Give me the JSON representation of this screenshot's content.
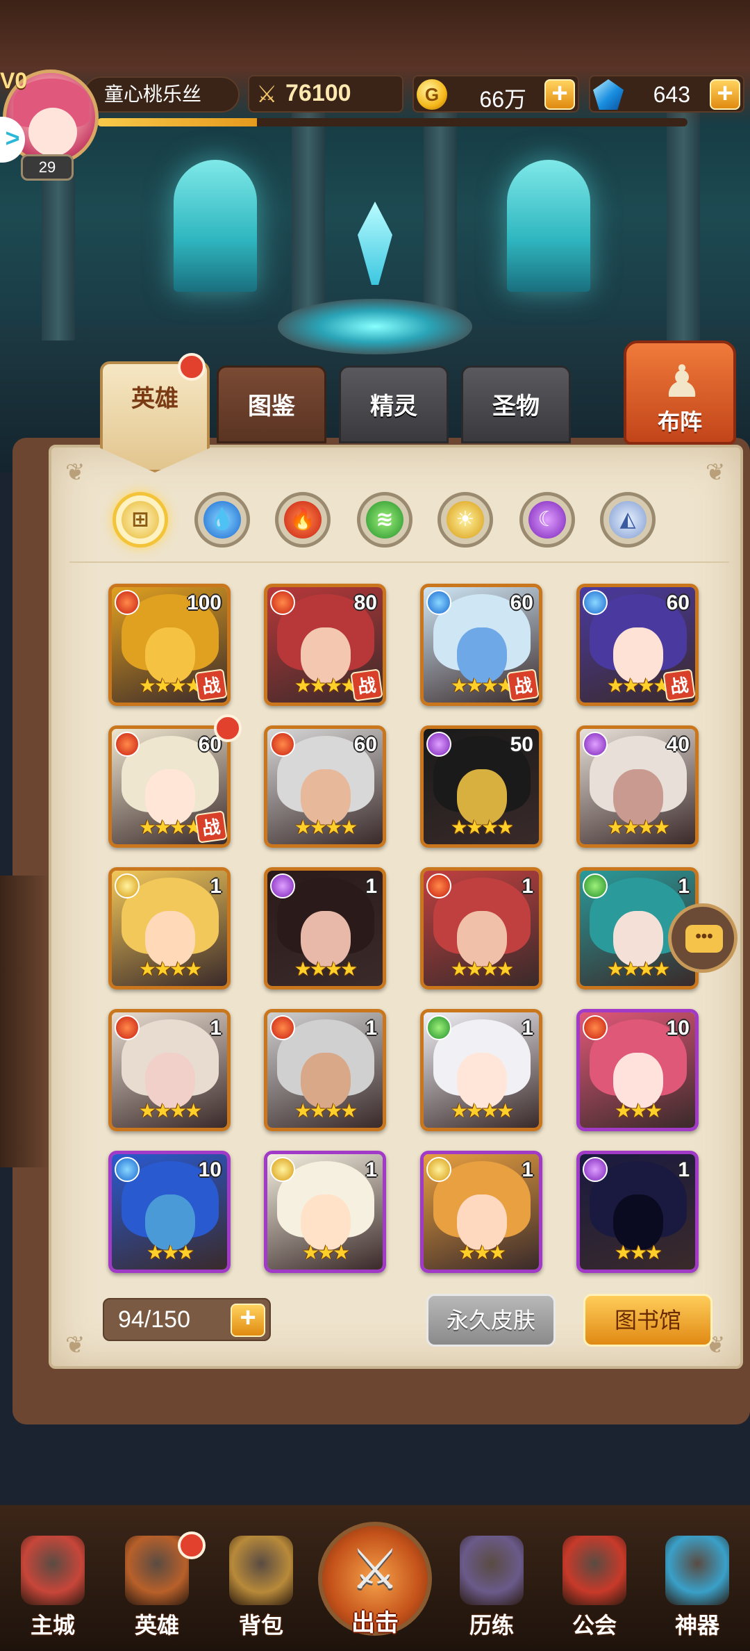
{
  "player": {
    "vip_label": "V0",
    "name": "童心桃乐丝",
    "level": "29",
    "exp_fraction": 0.27
  },
  "resources": {
    "power": "76100",
    "gold": "66万",
    "gems": "643",
    "gold_icon": "gold-coin-icon",
    "gem_icon": "blue-gem-icon"
  },
  "tabs": [
    {
      "label": "英雄"
    },
    {
      "label": "图鉴"
    },
    {
      "label": "精灵"
    },
    {
      "label": "圣物"
    }
  ],
  "formation": {
    "label": "布阵"
  },
  "element_filters": [
    "all",
    "water",
    "fire",
    "wind",
    "light",
    "dark",
    "void"
  ],
  "heroes": [
    {
      "element": "fire",
      "level": "100",
      "stars": "★★★★",
      "in_team": "战",
      "frame": "orange",
      "hair": "#e0a020",
      "face": "#f5c242"
    },
    {
      "element": "fire",
      "level": "80",
      "stars": "★★★★",
      "in_team": "战",
      "frame": "orange",
      "hair": "#b8383a",
      "face": "#f3c7b0"
    },
    {
      "element": "water",
      "level": "60",
      "stars": "★★★★",
      "in_team": "战",
      "frame": "orange",
      "hair": "#cfe6f5",
      "face": "#6fa8e6"
    },
    {
      "element": "water",
      "level": "60",
      "stars": "★★★★",
      "in_team": "战",
      "frame": "orange",
      "hair": "#4a3aa0",
      "face": "#ffe2d6"
    },
    {
      "element": "fire",
      "level": "60",
      "stars": "★★★★",
      "in_team": "战",
      "frame": "orange",
      "hair": "#efe6d0",
      "face": "#ffe6d6"
    },
    {
      "element": "fire",
      "level": "60",
      "stars": "★★★★",
      "in_team": "",
      "frame": "orange",
      "hair": "#d8d8d8",
      "face": "#e8b89a"
    },
    {
      "element": "dark",
      "level": "50",
      "stars": "★★★★",
      "in_team": "",
      "frame": "orange",
      "hair": "#1a1a1a",
      "face": "#d8b040"
    },
    {
      "element": "dark",
      "level": "40",
      "stars": "★★★★",
      "in_team": "",
      "frame": "orange",
      "hair": "#e8e0d8",
      "face": "#c89a90"
    },
    {
      "element": "light",
      "level": "1",
      "stars": "★★★★",
      "in_team": "",
      "frame": "orange",
      "hair": "#f2c85a",
      "face": "#ffd9b8"
    },
    {
      "element": "dark",
      "level": "1",
      "stars": "★★★★",
      "in_team": "",
      "frame": "orange",
      "hair": "#2a1a1a",
      "face": "#e8b8a8"
    },
    {
      "element": "fire",
      "level": "1",
      "stars": "★★★★",
      "in_team": "",
      "frame": "orange",
      "hair": "#c04040",
      "face": "#f0c0a8"
    },
    {
      "element": "wind",
      "level": "1",
      "stars": "★★★★",
      "in_team": "",
      "frame": "orange",
      "hair": "#2a9a9a",
      "face": "#f5e0d8"
    },
    {
      "element": "fire",
      "level": "1",
      "stars": "★★★★",
      "in_team": "",
      "frame": "orange",
      "hair": "#e8dcd0",
      "face": "#f0d0c8"
    },
    {
      "element": "fire",
      "level": "1",
      "stars": "★★★★",
      "in_team": "",
      "frame": "orange",
      "hair": "#d0d0d0",
      "face": "#d8a888"
    },
    {
      "element": "wind",
      "level": "1",
      "stars": "★★★★",
      "in_team": "",
      "frame": "orange",
      "hair": "#f0f0f5",
      "face": "#ffe6d8"
    },
    {
      "element": "fire",
      "level": "10",
      "stars": "★★★",
      "in_team": "",
      "frame": "purple",
      "hair": "#e05878",
      "face": "#ffe2dc"
    },
    {
      "element": "water",
      "level": "10",
      "stars": "★★★",
      "in_team": "",
      "frame": "purple",
      "hair": "#2a5ad0",
      "face": "#4a9ad8"
    },
    {
      "element": "light",
      "level": "1",
      "stars": "★★★",
      "in_team": "",
      "frame": "purple",
      "hair": "#f5f0e0",
      "face": "#ffe2c8"
    },
    {
      "element": "light",
      "level": "1",
      "stars": "★★★",
      "in_team": "",
      "frame": "purple",
      "hair": "#e8a040",
      "face": "#ffd8c0"
    },
    {
      "element": "dark",
      "level": "1",
      "stars": "★★★",
      "in_team": "",
      "frame": "purple",
      "hair": "#1a1a40",
      "face": "#0a0a20"
    }
  ],
  "hero_count": "94/150",
  "buttons": {
    "skin": "永久皮肤",
    "library": "图书馆"
  },
  "nav": [
    {
      "label": "主城",
      "icon": "castle-icon",
      "color": "#c8463a"
    },
    {
      "label": "英雄",
      "icon": "hero-icon",
      "color": "#b8602a"
    },
    {
      "label": "背包",
      "icon": "backpack-icon",
      "color": "#b88a3a"
    },
    {
      "label": "出击",
      "icon": "crossed-swords-icon"
    },
    {
      "label": "历练",
      "icon": "tower-icon",
      "color": "#6a5a8a"
    },
    {
      "label": "公会",
      "icon": "guild-shield-icon",
      "color": "#c83a2a"
    },
    {
      "label": "神器",
      "icon": "artifact-icon",
      "color": "#3aa0c8"
    }
  ]
}
